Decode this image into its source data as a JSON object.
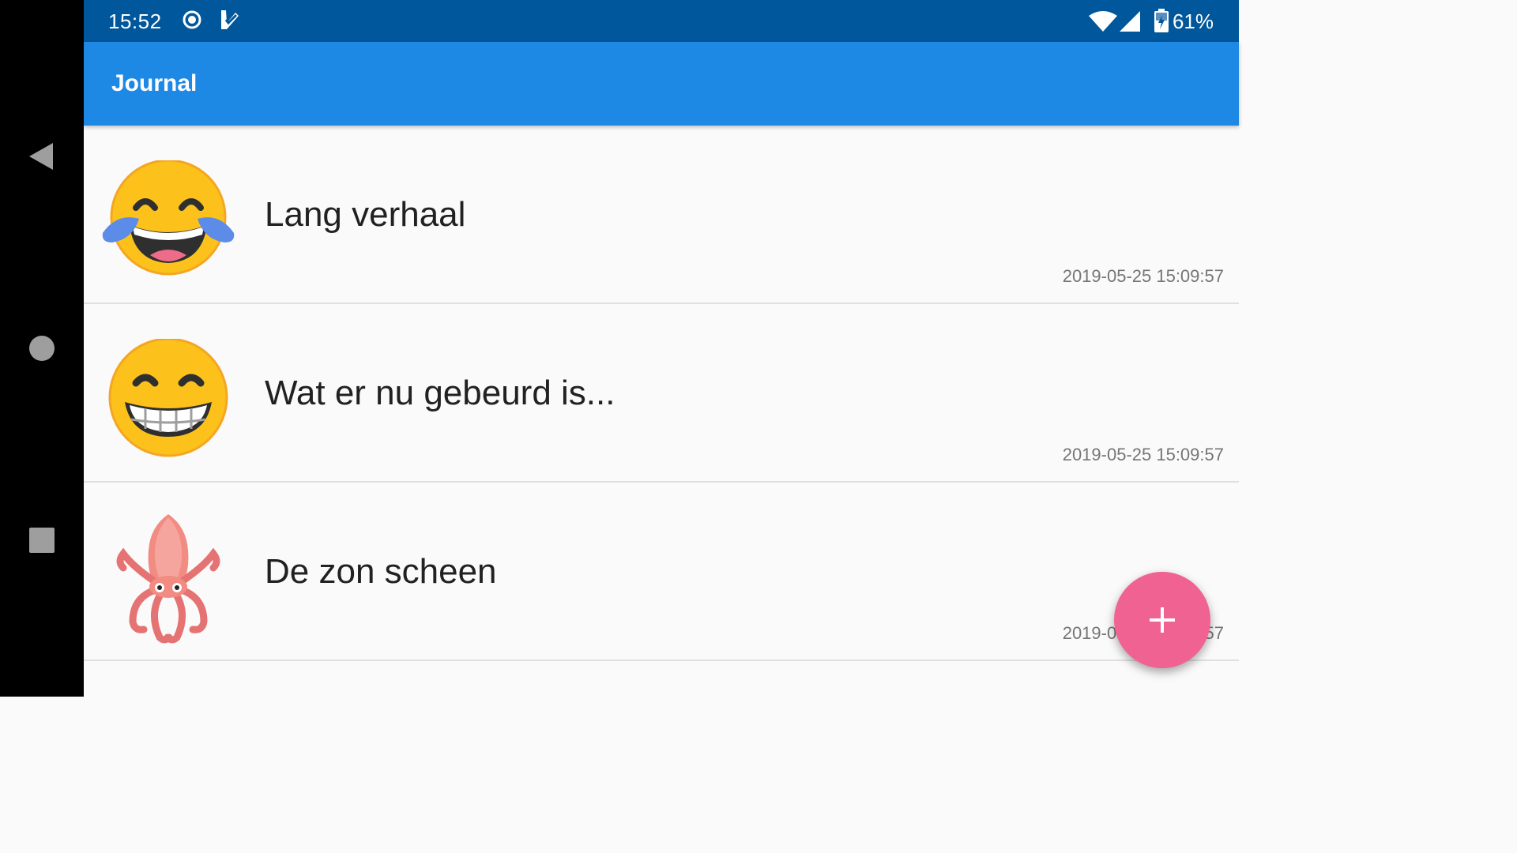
{
  "status_bar": {
    "time": "15:52",
    "battery": "61%",
    "icons": [
      "radio-button-icon",
      "check-badge-icon",
      "wifi-icon",
      "signal-icon",
      "battery-charging-icon"
    ],
    "background": "#01579b"
  },
  "app_bar": {
    "title": "Journal",
    "background": "#1e88e5"
  },
  "entries": [
    {
      "title": "Lang verhaal",
      "date": "2019-05-25 15:09:57",
      "icon": "tears-of-joy-emoji-icon"
    },
    {
      "title": "Wat er nu gebeurd is...",
      "date": "2019-05-25 15:09:57",
      "icon": "grinning-face-emoji-icon"
    },
    {
      "title": "De zon scheen",
      "date": "2019-05-25 15:09:57",
      "icon": "squid-emoji-icon"
    }
  ],
  "fab": {
    "icon": "plus-icon",
    "color": "#f06292"
  },
  "navigation": {
    "buttons": [
      "back-icon",
      "home-icon",
      "recents-icon"
    ]
  }
}
